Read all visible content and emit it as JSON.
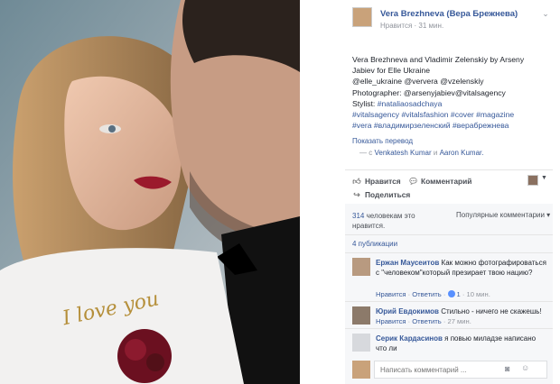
{
  "post": {
    "author": "Vera Brezhneva (Вера Брежнева)",
    "meta_like": "Нравится",
    "meta_time": "· 31 мин.",
    "caption_lines": [
      "Vera Brezhneva and Vladimir Zelenskiy by Arseny",
      "Jabiev for Elle Ukraine",
      "@elle_ukraine @ververa @vzelenskiy",
      "Photographer: @arsenyjabiev@vitalsagency",
      "Stylist: ",
      "#vitalsagency #vitalsfashion #cover #magazine",
      "#vera #владимирзеленский #верабрежнева"
    ],
    "stylist_tag": "#nataliaosadchaya",
    "show_translation": "Показать перевод",
    "with_prefix": "— с",
    "with_person1": "Venkatesh Kumar",
    "with_and": "и",
    "with_person2": "Aaron Kumar."
  },
  "actions": {
    "like": "Нравится",
    "comment": "Комментарий",
    "share": "Поделиться"
  },
  "comments_section": {
    "likes_num": "314",
    "likes_rest": "человекам это нравится.",
    "popular": "Популярные комментарии ▾",
    "publications": "4 публикации",
    "items": [
      {
        "name": "Ержан Маусеитов",
        "text": "Как можно фотографироваться с \"человеком\"который презирает твою нацию?",
        "like": "Нравится",
        "reply": "Ответить",
        "likes": "1",
        "time": "· 10 мин."
      },
      {
        "name": "Юрий Евдокимов",
        "text": "Стильно - ничего не скажешь!",
        "like": "Нравится",
        "reply": "Ответить",
        "time": "· 27 мин."
      },
      {
        "name": "Серик Кардасинов",
        "text": "я повью миладзе написано что ли",
        "like": "",
        "reply": "",
        "time": ""
      }
    ],
    "input_placeholder": "Написать комментарий ..."
  },
  "photo": {
    "embroidery_text": "I love you"
  },
  "colors": {
    "link": "#365899",
    "muted": "#90949c",
    "panel_bg": "#f6f7f9"
  }
}
